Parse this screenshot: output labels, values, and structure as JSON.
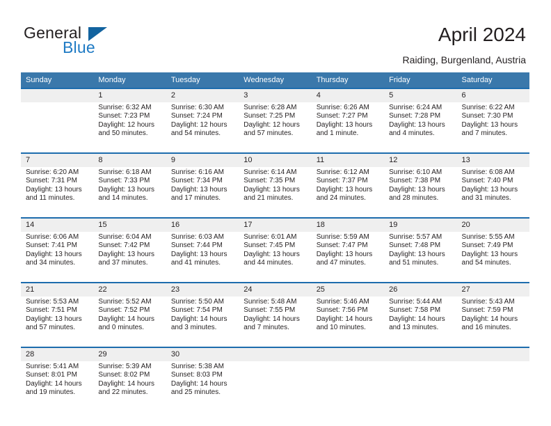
{
  "brand": {
    "name_top": "General",
    "name_bottom": "Blue",
    "accent_color": "#1e7ac4"
  },
  "header": {
    "title": "April 2024",
    "subtitle": "Raiding, Burgenland, Austria"
  },
  "theme": {
    "header_row_bg": "#3a78ab",
    "week_rule": "#1d6cad",
    "daynum_band": "#efefef",
    "text": "#231f20"
  },
  "calendar": {
    "weekday_headers": [
      "Sunday",
      "Monday",
      "Tuesday",
      "Wednesday",
      "Thursday",
      "Friday",
      "Saturday"
    ],
    "labels": {
      "sunrise": "Sunrise:",
      "sunset": "Sunset:",
      "daylight": "Daylight:"
    },
    "weeks": [
      [
        {
          "day": "",
          "sunrise": "",
          "sunset": "",
          "daylight": ""
        },
        {
          "day": "1",
          "sunrise": "Sunrise: 6:32 AM",
          "sunset": "Sunset: 7:23 PM",
          "daylight": "Daylight: 12 hours and 50 minutes."
        },
        {
          "day": "2",
          "sunrise": "Sunrise: 6:30 AM",
          "sunset": "Sunset: 7:24 PM",
          "daylight": "Daylight: 12 hours and 54 minutes."
        },
        {
          "day": "3",
          "sunrise": "Sunrise: 6:28 AM",
          "sunset": "Sunset: 7:25 PM",
          "daylight": "Daylight: 12 hours and 57 minutes."
        },
        {
          "day": "4",
          "sunrise": "Sunrise: 6:26 AM",
          "sunset": "Sunset: 7:27 PM",
          "daylight": "Daylight: 13 hours and 1 minute."
        },
        {
          "day": "5",
          "sunrise": "Sunrise: 6:24 AM",
          "sunset": "Sunset: 7:28 PM",
          "daylight": "Daylight: 13 hours and 4 minutes."
        },
        {
          "day": "6",
          "sunrise": "Sunrise: 6:22 AM",
          "sunset": "Sunset: 7:30 PM",
          "daylight": "Daylight: 13 hours and 7 minutes."
        }
      ],
      [
        {
          "day": "7",
          "sunrise": "Sunrise: 6:20 AM",
          "sunset": "Sunset: 7:31 PM",
          "daylight": "Daylight: 13 hours and 11 minutes."
        },
        {
          "day": "8",
          "sunrise": "Sunrise: 6:18 AM",
          "sunset": "Sunset: 7:33 PM",
          "daylight": "Daylight: 13 hours and 14 minutes."
        },
        {
          "day": "9",
          "sunrise": "Sunrise: 6:16 AM",
          "sunset": "Sunset: 7:34 PM",
          "daylight": "Daylight: 13 hours and 17 minutes."
        },
        {
          "day": "10",
          "sunrise": "Sunrise: 6:14 AM",
          "sunset": "Sunset: 7:35 PM",
          "daylight": "Daylight: 13 hours and 21 minutes."
        },
        {
          "day": "11",
          "sunrise": "Sunrise: 6:12 AM",
          "sunset": "Sunset: 7:37 PM",
          "daylight": "Daylight: 13 hours and 24 minutes."
        },
        {
          "day": "12",
          "sunrise": "Sunrise: 6:10 AM",
          "sunset": "Sunset: 7:38 PM",
          "daylight": "Daylight: 13 hours and 28 minutes."
        },
        {
          "day": "13",
          "sunrise": "Sunrise: 6:08 AM",
          "sunset": "Sunset: 7:40 PM",
          "daylight": "Daylight: 13 hours and 31 minutes."
        }
      ],
      [
        {
          "day": "14",
          "sunrise": "Sunrise: 6:06 AM",
          "sunset": "Sunset: 7:41 PM",
          "daylight": "Daylight: 13 hours and 34 minutes."
        },
        {
          "day": "15",
          "sunrise": "Sunrise: 6:04 AM",
          "sunset": "Sunset: 7:42 PM",
          "daylight": "Daylight: 13 hours and 37 minutes."
        },
        {
          "day": "16",
          "sunrise": "Sunrise: 6:03 AM",
          "sunset": "Sunset: 7:44 PM",
          "daylight": "Daylight: 13 hours and 41 minutes."
        },
        {
          "day": "17",
          "sunrise": "Sunrise: 6:01 AM",
          "sunset": "Sunset: 7:45 PM",
          "daylight": "Daylight: 13 hours and 44 minutes."
        },
        {
          "day": "18",
          "sunrise": "Sunrise: 5:59 AM",
          "sunset": "Sunset: 7:47 PM",
          "daylight": "Daylight: 13 hours and 47 minutes."
        },
        {
          "day": "19",
          "sunrise": "Sunrise: 5:57 AM",
          "sunset": "Sunset: 7:48 PM",
          "daylight": "Daylight: 13 hours and 51 minutes."
        },
        {
          "day": "20",
          "sunrise": "Sunrise: 5:55 AM",
          "sunset": "Sunset: 7:49 PM",
          "daylight": "Daylight: 13 hours and 54 minutes."
        }
      ],
      [
        {
          "day": "21",
          "sunrise": "Sunrise: 5:53 AM",
          "sunset": "Sunset: 7:51 PM",
          "daylight": "Daylight: 13 hours and 57 minutes."
        },
        {
          "day": "22",
          "sunrise": "Sunrise: 5:52 AM",
          "sunset": "Sunset: 7:52 PM",
          "daylight": "Daylight: 14 hours and 0 minutes."
        },
        {
          "day": "23",
          "sunrise": "Sunrise: 5:50 AM",
          "sunset": "Sunset: 7:54 PM",
          "daylight": "Daylight: 14 hours and 3 minutes."
        },
        {
          "day": "24",
          "sunrise": "Sunrise: 5:48 AM",
          "sunset": "Sunset: 7:55 PM",
          "daylight": "Daylight: 14 hours and 7 minutes."
        },
        {
          "day": "25",
          "sunrise": "Sunrise: 5:46 AM",
          "sunset": "Sunset: 7:56 PM",
          "daylight": "Daylight: 14 hours and 10 minutes."
        },
        {
          "day": "26",
          "sunrise": "Sunrise: 5:44 AM",
          "sunset": "Sunset: 7:58 PM",
          "daylight": "Daylight: 14 hours and 13 minutes."
        },
        {
          "day": "27",
          "sunrise": "Sunrise: 5:43 AM",
          "sunset": "Sunset: 7:59 PM",
          "daylight": "Daylight: 14 hours and 16 minutes."
        }
      ],
      [
        {
          "day": "28",
          "sunrise": "Sunrise: 5:41 AM",
          "sunset": "Sunset: 8:01 PM",
          "daylight": "Daylight: 14 hours and 19 minutes."
        },
        {
          "day": "29",
          "sunrise": "Sunrise: 5:39 AM",
          "sunset": "Sunset: 8:02 PM",
          "daylight": "Daylight: 14 hours and 22 minutes."
        },
        {
          "day": "30",
          "sunrise": "Sunrise: 5:38 AM",
          "sunset": "Sunset: 8:03 PM",
          "daylight": "Daylight: 14 hours and 25 minutes."
        },
        {
          "day": "",
          "sunrise": "",
          "sunset": "",
          "daylight": ""
        },
        {
          "day": "",
          "sunrise": "",
          "sunset": "",
          "daylight": ""
        },
        {
          "day": "",
          "sunrise": "",
          "sunset": "",
          "daylight": ""
        },
        {
          "day": "",
          "sunrise": "",
          "sunset": "",
          "daylight": ""
        }
      ]
    ]
  }
}
